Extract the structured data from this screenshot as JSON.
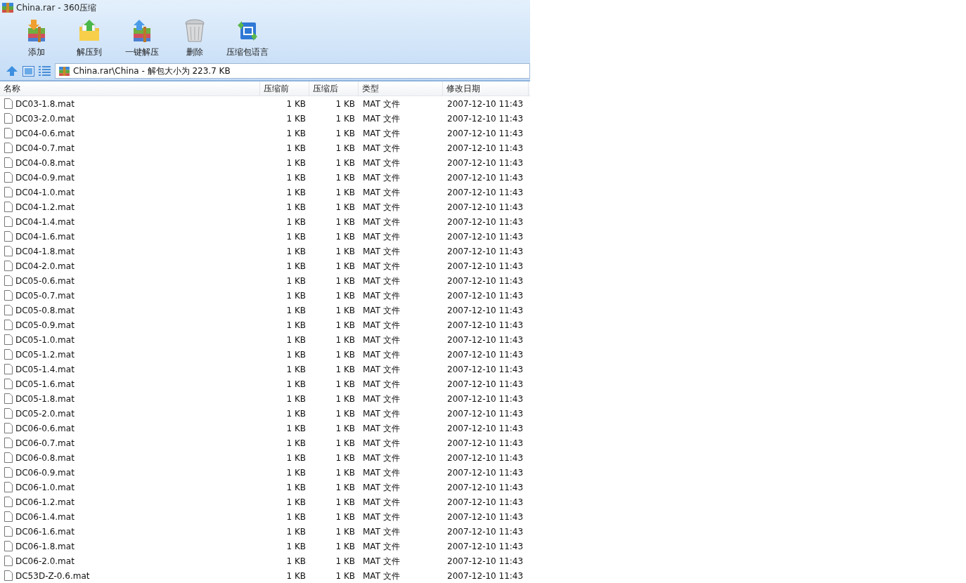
{
  "window": {
    "title": "China.rar - 360压缩"
  },
  "toolbar": [
    {
      "kind": "add",
      "label": "添加"
    },
    {
      "kind": "extract",
      "label": "解压到"
    },
    {
      "kind": "oneclick",
      "label": "一键解压"
    },
    {
      "kind": "delete",
      "label": "删除"
    },
    {
      "kind": "language",
      "label": "压缩包语言"
    }
  ],
  "address_bar": {
    "path": "China.rar\\China - 解包大小为 223.7 KB"
  },
  "table": {
    "columns": [
      "名称",
      "压缩前",
      "压缩后",
      "类型",
      "修改日期"
    ],
    "rows": [
      [
        "DC03-1.8.mat",
        "1 KB",
        "1 KB",
        "MAT 文件",
        "2007-12-10 11:43"
      ],
      [
        "DC03-2.0.mat",
        "1 KB",
        "1 KB",
        "MAT 文件",
        "2007-12-10 11:43"
      ],
      [
        "DC04-0.6.mat",
        "1 KB",
        "1 KB",
        "MAT 文件",
        "2007-12-10 11:43"
      ],
      [
        "DC04-0.7.mat",
        "1 KB",
        "1 KB",
        "MAT 文件",
        "2007-12-10 11:43"
      ],
      [
        "DC04-0.8.mat",
        "1 KB",
        "1 KB",
        "MAT 文件",
        "2007-12-10 11:43"
      ],
      [
        "DC04-0.9.mat",
        "1 KB",
        "1 KB",
        "MAT 文件",
        "2007-12-10 11:43"
      ],
      [
        "DC04-1.0.mat",
        "1 KB",
        "1 KB",
        "MAT 文件",
        "2007-12-10 11:43"
      ],
      [
        "DC04-1.2.mat",
        "1 KB",
        "1 KB",
        "MAT 文件",
        "2007-12-10 11:43"
      ],
      [
        "DC04-1.4.mat",
        "1 KB",
        "1 KB",
        "MAT 文件",
        "2007-12-10 11:43"
      ],
      [
        "DC04-1.6.mat",
        "1 KB",
        "1 KB",
        "MAT 文件",
        "2007-12-10 11:43"
      ],
      [
        "DC04-1.8.mat",
        "1 KB",
        "1 KB",
        "MAT 文件",
        "2007-12-10 11:43"
      ],
      [
        "DC04-2.0.mat",
        "1 KB",
        "1 KB",
        "MAT 文件",
        "2007-12-10 11:43"
      ],
      [
        "DC05-0.6.mat",
        "1 KB",
        "1 KB",
        "MAT 文件",
        "2007-12-10 11:43"
      ],
      [
        "DC05-0.7.mat",
        "1 KB",
        "1 KB",
        "MAT 文件",
        "2007-12-10 11:43"
      ],
      [
        "DC05-0.8.mat",
        "1 KB",
        "1 KB",
        "MAT 文件",
        "2007-12-10 11:43"
      ],
      [
        "DC05-0.9.mat",
        "1 KB",
        "1 KB",
        "MAT 文件",
        "2007-12-10 11:43"
      ],
      [
        "DC05-1.0.mat",
        "1 KB",
        "1 KB",
        "MAT 文件",
        "2007-12-10 11:43"
      ],
      [
        "DC05-1.2.mat",
        "1 KB",
        "1 KB",
        "MAT 文件",
        "2007-12-10 11:43"
      ],
      [
        "DC05-1.4.mat",
        "1 KB",
        "1 KB",
        "MAT 文件",
        "2007-12-10 11:43"
      ],
      [
        "DC05-1.6.mat",
        "1 KB",
        "1 KB",
        "MAT 文件",
        "2007-12-10 11:43"
      ],
      [
        "DC05-1.8.mat",
        "1 KB",
        "1 KB",
        "MAT 文件",
        "2007-12-10 11:43"
      ],
      [
        "DC05-2.0.mat",
        "1 KB",
        "1 KB",
        "MAT 文件",
        "2007-12-10 11:43"
      ],
      [
        "DC06-0.6.mat",
        "1 KB",
        "1 KB",
        "MAT 文件",
        "2007-12-10 11:43"
      ],
      [
        "DC06-0.7.mat",
        "1 KB",
        "1 KB",
        "MAT 文件",
        "2007-12-10 11:43"
      ],
      [
        "DC06-0.8.mat",
        "1 KB",
        "1 KB",
        "MAT 文件",
        "2007-12-10 11:43"
      ],
      [
        "DC06-0.9.mat",
        "1 KB",
        "1 KB",
        "MAT 文件",
        "2007-12-10 11:43"
      ],
      [
        "DC06-1.0.mat",
        "1 KB",
        "1 KB",
        "MAT 文件",
        "2007-12-10 11:43"
      ],
      [
        "DC06-1.2.mat",
        "1 KB",
        "1 KB",
        "MAT 文件",
        "2007-12-10 11:43"
      ],
      [
        "DC06-1.4.mat",
        "1 KB",
        "1 KB",
        "MAT 文件",
        "2007-12-10 11:43"
      ],
      [
        "DC06-1.6.mat",
        "1 KB",
        "1 KB",
        "MAT 文件",
        "2007-12-10 11:43"
      ],
      [
        "DC06-1.8.mat",
        "1 KB",
        "1 KB",
        "MAT 文件",
        "2007-12-10 11:43"
      ],
      [
        "DC06-2.0.mat",
        "1 KB",
        "1 KB",
        "MAT 文件",
        "2007-12-10 11:43"
      ],
      [
        "DC53D-Z-0.6.mat",
        "1 KB",
        "1 KB",
        "MAT 文件",
        "2007-12-10 11:43"
      ]
    ]
  }
}
